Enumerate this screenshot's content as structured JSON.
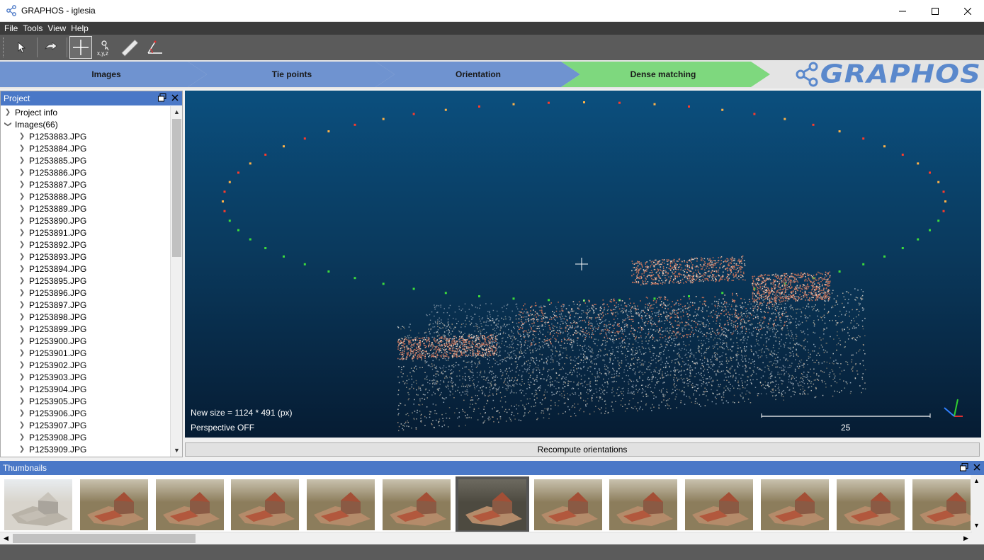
{
  "window": {
    "title": "GRAPHOS - iglesia"
  },
  "menu": [
    "File",
    "Tools",
    "View",
    "Help"
  ],
  "toolbar": {
    "buttons": [
      {
        "name": "select-tool",
        "icon": "cursor-arrow-icon"
      },
      {
        "name": "rotate-tool",
        "icon": "rotate-hand-icon"
      },
      {
        "name": "crosshair-tool",
        "icon": "crosshair-icon",
        "active": true
      },
      {
        "name": "point-coordinates-tool",
        "icon": "point-xyz-icon",
        "label": "x,y,z"
      },
      {
        "name": "measure-distance-tool",
        "icon": "ruler-icon"
      },
      {
        "name": "measure-angle-tool",
        "icon": "angle-icon"
      }
    ]
  },
  "workflow": {
    "steps": [
      "Images",
      "Tie points",
      "Orientation",
      "Dense matching"
    ],
    "logo": "GRAPHOS",
    "colors": {
      "step": "#6f93d0",
      "active": "#7ed87e"
    }
  },
  "project": {
    "header": "Project",
    "project_info": "Project info",
    "images_label": "Images(66)",
    "images": [
      "P1253883.JPG",
      "P1253884.JPG",
      "P1253885.JPG",
      "P1253886.JPG",
      "P1253887.JPG",
      "P1253888.JPG",
      "P1253889.JPG",
      "P1253890.JPG",
      "P1253891.JPG",
      "P1253892.JPG",
      "P1253893.JPG",
      "P1253894.JPG",
      "P1253895.JPG",
      "P1253896.JPG",
      "P1253897.JPG",
      "P1253898.JPG",
      "P1253899.JPG",
      "P1253900.JPG",
      "P1253901.JPG",
      "P1253902.JPG",
      "P1253903.JPG",
      "P1253904.JPG",
      "P1253905.JPG",
      "P1253906.JPG",
      "P1253907.JPG",
      "P1253908.JPG",
      "P1253909.JPG"
    ]
  },
  "viewer": {
    "new_size": "New size = 1124 * 491 (px)",
    "perspective": "Perspective OFF",
    "scale_value": "25",
    "axes_colors": {
      "x": "#e03030",
      "y": "#30d030",
      "z": "#3080ff"
    }
  },
  "recompute_label": "Recompute orientations",
  "thumbnails": {
    "header": "Thumbnails",
    "count_visible": 13,
    "selected_index": 6
  }
}
